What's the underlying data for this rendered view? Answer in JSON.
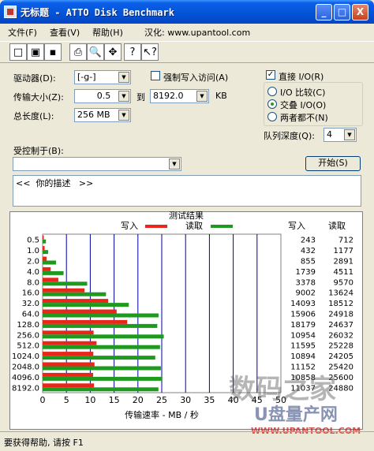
{
  "window": {
    "title": "无标题 - ATTO Disk Benchmark",
    "minimize": "_",
    "maximize": "□",
    "close": "X"
  },
  "menu": [
    "文件(F)",
    "查看(V)",
    "帮助(H)",
    "汉化: www.upantool.com"
  ],
  "toolbar": {
    "icons": [
      "new-icon",
      "open-icon",
      "save-icon",
      "print-icon",
      "print-preview-icon",
      "move-icon",
      "help-icon",
      "context-help-icon"
    ],
    "glyphs": [
      "□",
      "▣",
      "▪",
      "⎙",
      "🔍",
      "✥",
      "?",
      "↖?"
    ]
  },
  "form": {
    "drive_label": "驱动器(D):",
    "drive_value": "[-g-]",
    "force_write_label": "强制写入访问(A)",
    "transfer_label": "传输大小(Z):",
    "transfer_from": "0.5",
    "transfer_to_label": "到",
    "transfer_to": "8192.0",
    "transfer_unit": "KB",
    "total_length_label": "总长度(L):",
    "total_length": "256 MB",
    "direct_io_label": "直接 I/O(R)",
    "direct_io_checked": "✓",
    "radio_io_compare": "I/O 比较(C)",
    "radio_overlap": "交叠 I/O(O)",
    "radio_neither": "两者都不(N)",
    "queue_label": "队列深度(Q):",
    "queue_value": "4",
    "controlled_label": "受控制于(B):",
    "controlled_value": "",
    "start_button": "开始(S)",
    "description": "<<  你的描述   >>"
  },
  "chart_data": {
    "type": "bar",
    "title": "测试结果",
    "legend": [
      {
        "name": "写入",
        "color": "#e8261a"
      },
      {
        "name": "读取",
        "color": "#1e9a1e"
      }
    ],
    "xlabel": "传输速率 - MB / 秒",
    "x_ticks": [
      "0",
      "5",
      "10",
      "15",
      "20",
      "25",
      "30",
      "35",
      "40",
      "45",
      "50"
    ],
    "xlim": [
      0,
      50
    ],
    "column_headers": [
      "写入",
      "读取"
    ],
    "categories": [
      "0.5",
      "1.0",
      "2.0",
      "4.0",
      "8.0",
      "16.0",
      "32.0",
      "64.0",
      "128.0",
      "256.0",
      "512.0",
      "1024.0",
      "2048.0",
      "4096.0",
      "8192.0"
    ],
    "series": [
      {
        "name": "写入",
        "values": [
          0.24,
          0.42,
          0.83,
          1.7,
          3.3,
          8.79,
          13.76,
          15.53,
          17.75,
          10.7,
          11.32,
          10.64,
          10.89,
          10.6,
          10.78
        ]
      },
      {
        "name": "读取",
        "values": [
          0.7,
          1.15,
          2.82,
          4.4,
          9.35,
          13.3,
          18.08,
          24.33,
          24.06,
          25.42,
          24.64,
          23.64,
          24.82,
          25.0,
          24.3
        ]
      }
    ],
    "write_labels": [
      "243",
      "432",
      "855",
      "1739",
      "3378",
      "9002",
      "14093",
      "15906",
      "18179",
      "10954",
      "11595",
      "10894",
      "11152",
      "10858",
      "11037"
    ],
    "read_labels": [
      "712",
      "1177",
      "2891",
      "4511",
      "9570",
      "13624",
      "18512",
      "24918",
      "24637",
      "26032",
      "25228",
      "24205",
      "25420",
      "25600",
      "24880"
    ]
  },
  "status": {
    "text": "要获得帮助, 请按 F1"
  },
  "watermark": {
    "line1": "数码之家",
    "line2": "U盘量产网",
    "line3": "WWW.UPANTOOL.COM"
  }
}
